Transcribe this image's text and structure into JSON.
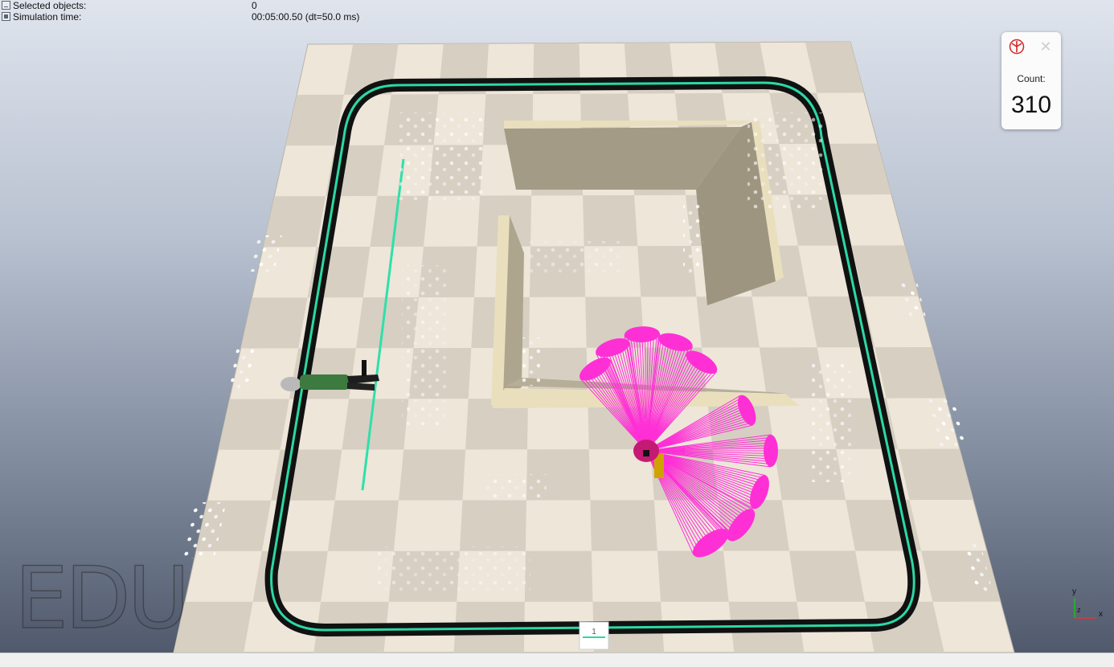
{
  "info_panel": {
    "selected_objects_label": "Selected objects:",
    "selected_objects_value": "0",
    "simulation_time_label": "Simulation time:",
    "simulation_time_value": "00:05:00.50 (dt=50.0 ms)"
  },
  "counter_widget": {
    "logo_icon": "coppeliasim-logo-icon",
    "close_icon": "close-icon",
    "label": "Count:",
    "value": "310"
  },
  "watermark": {
    "text": "EDU"
  },
  "scene": {
    "start_marker_text": "1",
    "colors": {
      "floor_light": "#ede6d9",
      "floor_dark": "#d6cfc2",
      "track_line": "#2bd9a3",
      "track_border": "#111111",
      "wall_face": "#a49b86",
      "wall_top": "#eadfbd",
      "sensor_rays": "#ff2fd6",
      "robot": "#c41a73"
    }
  },
  "axis_widget": {
    "x_label": "x",
    "y_label": "y",
    "z_label": "z"
  }
}
